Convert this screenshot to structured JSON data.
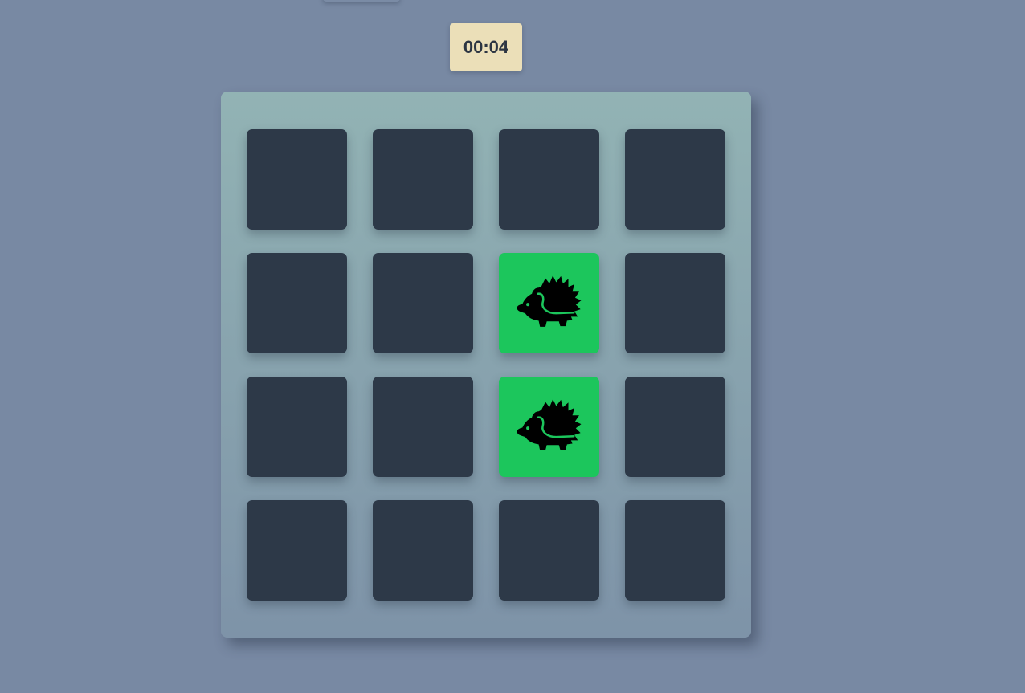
{
  "timer": {
    "display": "00:04"
  },
  "colors": {
    "page_background": "#7889a3",
    "timer_background": "#ebdfb8",
    "card_back": "#2d3948",
    "card_matched": "#1cc65c"
  },
  "board": {
    "rows": 4,
    "columns": 4,
    "cards": [
      {
        "row": 1,
        "col": 1,
        "state": "face-down",
        "icon": ""
      },
      {
        "row": 1,
        "col": 2,
        "state": "face-down",
        "icon": ""
      },
      {
        "row": 1,
        "col": 3,
        "state": "face-down",
        "icon": ""
      },
      {
        "row": 1,
        "col": 4,
        "state": "face-down",
        "icon": ""
      },
      {
        "row": 2,
        "col": 1,
        "state": "face-down",
        "icon": ""
      },
      {
        "row": 2,
        "col": 2,
        "state": "face-down",
        "icon": ""
      },
      {
        "row": 2,
        "col": 3,
        "state": "face-up",
        "icon": "hedgehog-icon"
      },
      {
        "row": 2,
        "col": 4,
        "state": "face-down",
        "icon": ""
      },
      {
        "row": 3,
        "col": 1,
        "state": "face-down",
        "icon": ""
      },
      {
        "row": 3,
        "col": 2,
        "state": "face-down",
        "icon": ""
      },
      {
        "row": 3,
        "col": 3,
        "state": "face-up",
        "icon": "hedgehog-icon"
      },
      {
        "row": 3,
        "col": 4,
        "state": "face-down",
        "icon": ""
      },
      {
        "row": 4,
        "col": 1,
        "state": "face-down",
        "icon": ""
      },
      {
        "row": 4,
        "col": 2,
        "state": "face-down",
        "icon": ""
      },
      {
        "row": 4,
        "col": 3,
        "state": "face-down",
        "icon": ""
      },
      {
        "row": 4,
        "col": 4,
        "state": "face-down",
        "icon": ""
      }
    ]
  }
}
